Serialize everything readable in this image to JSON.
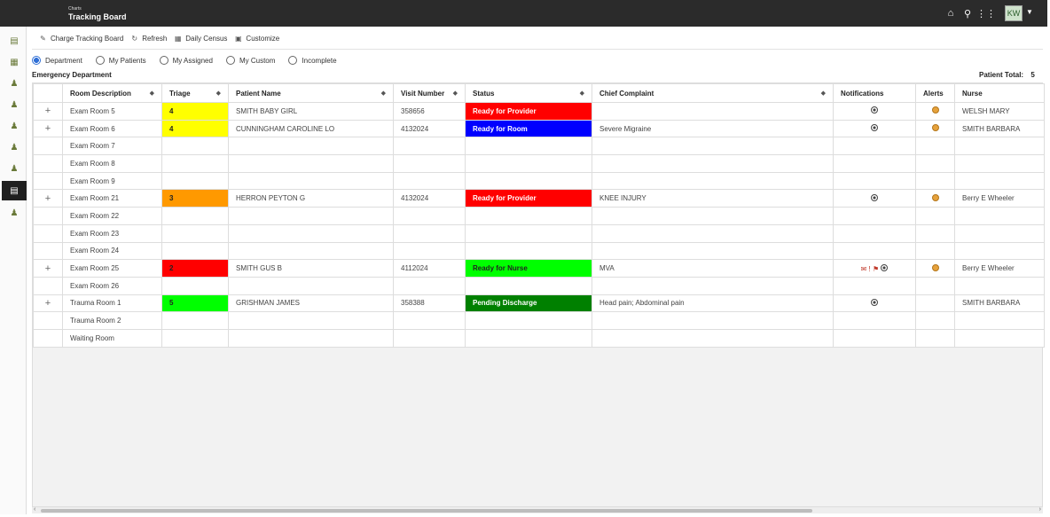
{
  "header": {
    "subtitle": "Charts",
    "title": "Tracking Board",
    "user_initials": "KW"
  },
  "toolbar": [
    {
      "label": "Charge Tracking Board",
      "icon": "edit-icon"
    },
    {
      "label": "Refresh",
      "icon": "refresh-icon"
    },
    {
      "label": "Daily Census",
      "icon": "grid-icon"
    },
    {
      "label": "Customize",
      "icon": "calendar-icon"
    }
  ],
  "filters": [
    {
      "label": "Department",
      "checked": true
    },
    {
      "label": "My Patients",
      "checked": false
    },
    {
      "label": "My Assigned",
      "checked": false
    },
    {
      "label": "My Custom",
      "checked": false
    },
    {
      "label": "Incomplete",
      "checked": false
    }
  ],
  "section": {
    "title": "Emergency Department",
    "patient_total_label": "Patient Total:",
    "patient_total_value": "5"
  },
  "columns": [
    "Room Description",
    "Triage",
    "Patient Name",
    "Visit Number",
    "Status",
    "Chief Complaint",
    "Notifications",
    "Alerts",
    "Nurse"
  ],
  "colors": {
    "triage_yellow": "#ffff00",
    "triage_orange": "#ff9900",
    "triage_red": "#ff0000",
    "triage_green": "#00ff00",
    "status_red": "#ff0000",
    "status_blue": "#0000ff",
    "status_lime": "#00ff00",
    "status_darkgreen": "#008000"
  },
  "rows": [
    {
      "expandable": true,
      "room": "Exam Room 5",
      "triage": "4",
      "triage_color": "#ffff00",
      "patient": "SMITH BABY GIRL",
      "visit": "358656",
      "status": "Ready for Provider",
      "status_color": "#ff0000",
      "status_text_color": "#ffffff",
      "complaint": "",
      "notification": true,
      "notification_extra": false,
      "alert": true,
      "nurse": "WELSH MARY"
    },
    {
      "expandable": true,
      "room": "Exam Room 6",
      "triage": "4",
      "triage_color": "#ffff00",
      "patient": "CUNNINGHAM CAROLINE LO",
      "visit": "4132024",
      "status": "Ready for Room",
      "status_color": "#0000ff",
      "status_text_color": "#ffffff",
      "complaint": "Severe Migraine",
      "notification": true,
      "notification_extra": false,
      "alert": true,
      "nurse": "SMITH BARBARA"
    },
    {
      "expandable": false,
      "room": "Exam Room 7"
    },
    {
      "expandable": false,
      "room": "Exam Room 8"
    },
    {
      "expandable": false,
      "room": "Exam Room 9"
    },
    {
      "expandable": true,
      "room": "Exam Room 21",
      "triage": "3",
      "triage_color": "#ff9900",
      "patient": "HERRON PEYTON G",
      "visit": "4132024",
      "status": "Ready for Provider",
      "status_color": "#ff0000",
      "status_text_color": "#ffffff",
      "complaint": "KNEE INJURY",
      "notification": true,
      "notification_extra": false,
      "alert": true,
      "nurse": "Berry E Wheeler"
    },
    {
      "expandable": false,
      "room": "Exam Room 22"
    },
    {
      "expandable": false,
      "room": "Exam Room 23"
    },
    {
      "expandable": false,
      "room": "Exam Room 24"
    },
    {
      "expandable": true,
      "room": "Exam Room 25",
      "triage": "2",
      "triage_color": "#ff0000",
      "patient": "SMITH GUS B",
      "visit": "4112024",
      "status": "Ready for Nurse",
      "status_color": "#00ff00",
      "status_text_color": "#222222",
      "complaint": "MVA",
      "notification": true,
      "notification_extra": true,
      "alert": true,
      "nurse": "Berry E Wheeler"
    },
    {
      "expandable": false,
      "room": "Exam Room 26"
    },
    {
      "expandable": true,
      "room": "Trauma Room 1",
      "triage": "5",
      "triage_color": "#00ff00",
      "patient": "GRISHMAN JAMES",
      "visit": "358388",
      "status": "Pending Discharge",
      "status_color": "#008000",
      "status_text_color": "#ffffff",
      "complaint": "Head pain; Abdominal pain",
      "notification": true,
      "notification_extra": false,
      "alert": false,
      "nurse": "SMITH BARBARA"
    },
    {
      "expandable": false,
      "room": "Trauma Room 2"
    },
    {
      "expandable": false,
      "room": "Waiting Room"
    }
  ]
}
